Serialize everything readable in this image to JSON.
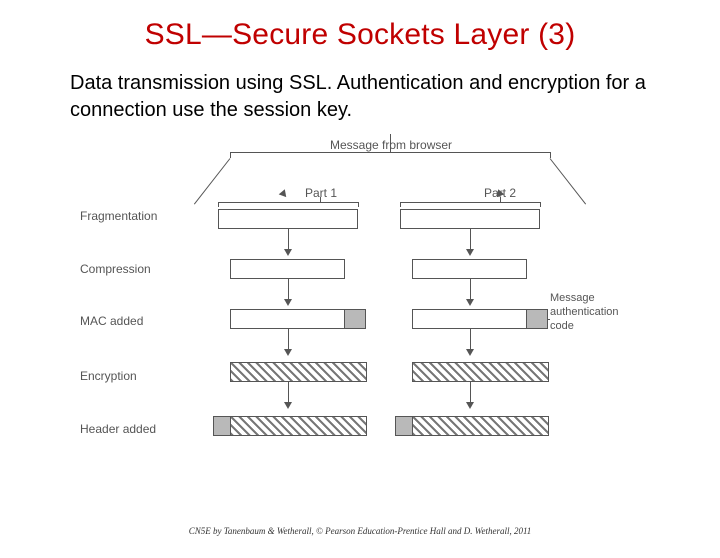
{
  "title": "SSL—Secure Sockets Layer (3)",
  "subtitle": "Data transmission using SSL. Authentication and encryption for a connection use the session key.",
  "diagram": {
    "top_label": "Message from browser",
    "parts": [
      "Part 1",
      "Part 2"
    ],
    "stages": {
      "fragmentation": "Fragmentation",
      "compression": "Compression",
      "mac": "MAC added",
      "encryption": "Encryption",
      "header": "Header added"
    },
    "right_label": "Message authentication code"
  },
  "footer": "CN5E by Tanenbaum & Wetherall, © Pearson Education-Prentice Hall and D. Wetherall, 2011"
}
